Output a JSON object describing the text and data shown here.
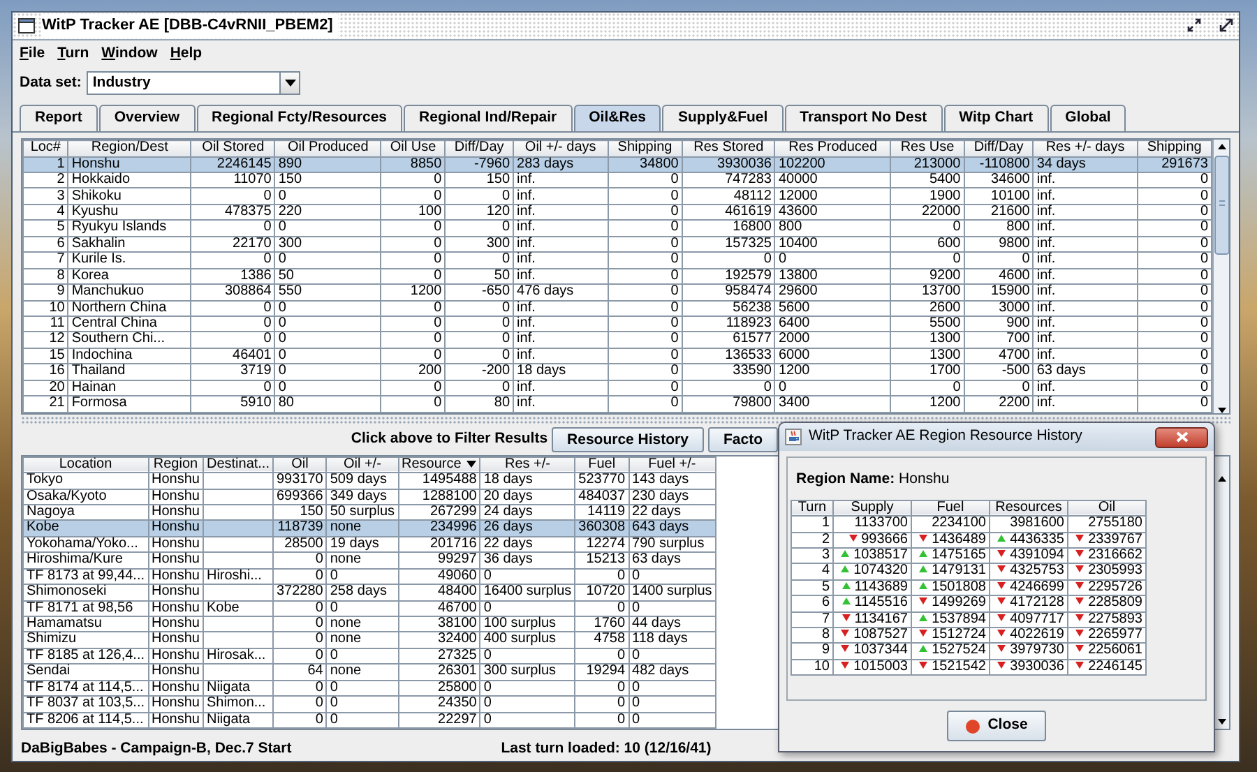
{
  "window": {
    "title": "WitP Tracker AE [DBB-C4vRNII_PBEM2]"
  },
  "menu": [
    "File",
    "Turn",
    "Window",
    "Help"
  ],
  "data_set": {
    "label": "Data set:",
    "value": "Industry"
  },
  "tabs": [
    {
      "label": "Report",
      "selected": false
    },
    {
      "label": "Overview",
      "selected": false
    },
    {
      "label": "Regional Fcty/Resources",
      "selected": false
    },
    {
      "label": "Regional Ind/Repair",
      "selected": false
    },
    {
      "label": "Oil&Res",
      "selected": true
    },
    {
      "label": "Supply&Fuel",
      "selected": false
    },
    {
      "label": "Transport No Dest",
      "selected": false
    },
    {
      "label": "Witp Chart",
      "selected": false
    },
    {
      "label": "Global",
      "selected": false
    }
  ],
  "top_table": {
    "columns": [
      "Loc#",
      "Region/Dest",
      "Oil Stored",
      "Oil Produced",
      "Oil Use",
      "Diff/Day",
      "Oil +/- days",
      "Shipping",
      "Res Stored",
      "Res Produced",
      "Res Use",
      "Diff/Day",
      "Res +/- days",
      "Shipping"
    ],
    "rows": [
      {
        "selected": true,
        "cells": [
          "1",
          "Honshu",
          "2246145",
          "890",
          "8850",
          "-7960",
          "283 days",
          "34800",
          "3930036",
          "102200",
          "213000",
          "-110800",
          "34 days",
          "291673"
        ]
      },
      {
        "selected": false,
        "cells": [
          "2",
          "Hokkaido",
          "11070",
          "150",
          "0",
          "150",
          "inf.",
          "0",
          "747283",
          "40000",
          "5400",
          "34600",
          "inf.",
          "0"
        ]
      },
      {
        "selected": false,
        "cells": [
          "3",
          "Shikoku",
          "0",
          "0",
          "0",
          "0",
          "inf.",
          "0",
          "48112",
          "12000",
          "1900",
          "10100",
          "inf.",
          "0"
        ]
      },
      {
        "selected": false,
        "cells": [
          "4",
          "Kyushu",
          "478375",
          "220",
          "100",
          "120",
          "inf.",
          "0",
          "461619",
          "43600",
          "22000",
          "21600",
          "inf.",
          "0"
        ]
      },
      {
        "selected": false,
        "cells": [
          "5",
          "Ryukyu Islands",
          "0",
          "0",
          "0",
          "0",
          "inf.",
          "0",
          "16800",
          "800",
          "0",
          "800",
          "inf.",
          "0"
        ]
      },
      {
        "selected": false,
        "cells": [
          "6",
          "Sakhalin",
          "22170",
          "300",
          "0",
          "300",
          "inf.",
          "0",
          "157325",
          "10400",
          "600",
          "9800",
          "inf.",
          "0"
        ]
      },
      {
        "selected": false,
        "cells": [
          "7",
          "Kurile Is.",
          "0",
          "0",
          "0",
          "0",
          "inf.",
          "0",
          "0",
          "0",
          "0",
          "0",
          "inf.",
          "0"
        ]
      },
      {
        "selected": false,
        "cells": [
          "8",
          "Korea",
          "1386",
          "50",
          "0",
          "50",
          "inf.",
          "0",
          "192579",
          "13800",
          "9200",
          "4600",
          "inf.",
          "0"
        ]
      },
      {
        "selected": false,
        "cells": [
          "9",
          "Manchukuo",
          "308864",
          "550",
          "1200",
          "-650",
          "476 days",
          "0",
          "958474",
          "29600",
          "13700",
          "15900",
          "inf.",
          "0"
        ]
      },
      {
        "selected": false,
        "cells": [
          "10",
          "Northern China",
          "0",
          "0",
          "0",
          "0",
          "inf.",
          "0",
          "56238",
          "5600",
          "2600",
          "3000",
          "inf.",
          "0"
        ]
      },
      {
        "selected": false,
        "cells": [
          "11",
          "Central China",
          "0",
          "0",
          "0",
          "0",
          "inf.",
          "0",
          "118923",
          "6400",
          "5500",
          "900",
          "inf.",
          "0"
        ]
      },
      {
        "selected": false,
        "cells": [
          "12",
          "Southern Chi...",
          "0",
          "0",
          "0",
          "0",
          "inf.",
          "0",
          "61577",
          "2000",
          "1300",
          "700",
          "inf.",
          "0"
        ]
      },
      {
        "selected": false,
        "cells": [
          "15",
          "Indochina",
          "46401",
          "0",
          "0",
          "0",
          "inf.",
          "0",
          "136533",
          "6000",
          "1300",
          "4700",
          "inf.",
          "0"
        ]
      },
      {
        "selected": false,
        "cells": [
          "16",
          "Thailand",
          "3719",
          "0",
          "200",
          "-200",
          "18 days",
          "0",
          "33590",
          "1200",
          "1700",
          "-500",
          "63 days",
          "0"
        ]
      },
      {
        "selected": false,
        "cells": [
          "20",
          "Hainan",
          "0",
          "0",
          "0",
          "0",
          "inf.",
          "0",
          "0",
          "0",
          "0",
          "0",
          "inf.",
          "0"
        ]
      },
      {
        "selected": false,
        "cells": [
          "21",
          "Formosa",
          "5910",
          "80",
          "0",
          "80",
          "inf.",
          "0",
          "79800",
          "3400",
          "1200",
          "2200",
          "inf.",
          "0"
        ]
      }
    ]
  },
  "filter_bar": {
    "hint": "Click above to Filter Results",
    "buttons": [
      "Resource History",
      "Facto"
    ]
  },
  "bottom_table": {
    "columns": [
      {
        "label": "Location",
        "sorted": false
      },
      {
        "label": "Region",
        "sorted": false
      },
      {
        "label": "Destinat...",
        "sorted": false
      },
      {
        "label": "Oil",
        "sorted": false
      },
      {
        "label": "Oil +/-",
        "sorted": false
      },
      {
        "label": "Resource",
        "sorted": true
      },
      {
        "label": "Res +/-",
        "sorted": false
      },
      {
        "label": "Fuel",
        "sorted": false
      },
      {
        "label": "Fuel +/-",
        "sorted": false
      }
    ],
    "rows": [
      {
        "selected": false,
        "location": "Tokyo",
        "region": "Honshu",
        "oil": "993170",
        "oil_change": "509 days",
        "resource": "1495488",
        "res_change": "18 days",
        "fuel": "523770",
        "fuel_change": "143 days"
      },
      {
        "selected": false,
        "location": "Osaka/Kyoto",
        "region": "Honshu",
        "oil": "699366",
        "oil_change": "349 days",
        "resource": "1288100",
        "res_change": "20 days",
        "fuel": "484037",
        "fuel_change": "230 days"
      },
      {
        "selected": false,
        "location": "Nagoya",
        "region": "Honshu",
        "oil": "150",
        "oil_change": "50 surplus",
        "resource": "267299",
        "res_change": "24 days",
        "fuel": "14119",
        "fuel_change": "22 days"
      },
      {
        "selected": true,
        "location": "Kobe",
        "region": "Honshu",
        "oil": "118739",
        "oil_change": "none",
        "resource": "234996",
        "res_change": "26 days",
        "fuel": "360308",
        "fuel_change": "643 days"
      },
      {
        "selected": false,
        "location": "Yokohama/Yoko...",
        "region": "Honshu",
        "oil": "28500",
        "oil_change": "19 days",
        "resource": "201716",
        "res_change": "22 days",
        "fuel": "12274",
        "fuel_change": "790 surplus"
      },
      {
        "selected": false,
        "location": "Hiroshima/Kure",
        "region": "Honshu",
        "oil": "0",
        "oil_change": "none",
        "resource": "99297",
        "res_change": "36 days",
        "fuel": "15213",
        "fuel_change": "63 days"
      },
      {
        "selected": false,
        "location": "TF 8173 at 99,44...",
        "region": "Honshu",
        "destination": "Hiroshi...",
        "oil": "0",
        "oil_change": "0",
        "resource": "49060",
        "res_change": "0",
        "fuel": "0",
        "fuel_change": "0"
      },
      {
        "selected": false,
        "location": "Shimonoseki",
        "region": "Honshu",
        "oil": "372280",
        "oil_change": "258 days",
        "resource": "48400",
        "res_change": "16400 surplus",
        "fuel": "10720",
        "fuel_change": "1400 surplus"
      },
      {
        "selected": false,
        "location": "TF 8171 at 98,56",
        "region": "Honshu",
        "destination": "Kobe",
        "oil": "0",
        "oil_change": "0",
        "resource": "46700",
        "res_change": "0",
        "fuel": "0",
        "fuel_change": "0"
      },
      {
        "selected": false,
        "location": "Hamamatsu",
        "region": "Honshu",
        "oil": "0",
        "oil_change": "none",
        "resource": "38100",
        "res_change": "100 surplus",
        "fuel": "1760",
        "fuel_change": "44 days"
      },
      {
        "selected": false,
        "location": "Shimizu",
        "region": "Honshu",
        "oil": "0",
        "oil_change": "none",
        "resource": "32400",
        "res_change": "400 surplus",
        "fuel": "4758",
        "fuel_change": "118 days"
      },
      {
        "selected": false,
        "location": "TF 8185 at 126,4...",
        "region": "Honshu",
        "destination": "Hirosak...",
        "oil": "0",
        "oil_change": "0",
        "resource": "27325",
        "res_change": "0",
        "fuel": "0",
        "fuel_change": "0"
      },
      {
        "selected": false,
        "location": "Sendai",
        "region": "Honshu",
        "oil": "64",
        "oil_change": "none",
        "resource": "26301",
        "res_change": "300 surplus",
        "fuel": "19294",
        "fuel_change": "482 days"
      },
      {
        "selected": false,
        "location": "TF 8174 at 114,5...",
        "region": "Honshu",
        "destination": "Niigata",
        "oil": "0",
        "oil_change": "0",
        "resource": "25800",
        "res_change": "0",
        "fuel": "0",
        "fuel_change": "0"
      },
      {
        "selected": false,
        "location": "TF 8037 at 103,5...",
        "region": "Honshu",
        "destination": "Shimon...",
        "oil": "0",
        "oil_change": "0",
        "resource": "24350",
        "res_change": "0",
        "fuel": "0",
        "fuel_change": "0"
      },
      {
        "selected": false,
        "location": "TF 8206 at 114,5...",
        "region": "Honshu",
        "destination": "Niigata",
        "oil": "0",
        "oil_change": "0",
        "resource": "22297",
        "res_change": "0",
        "fuel": "0",
        "fuel_change": "0"
      }
    ]
  },
  "status_bar": {
    "left": "DaBigBabes - Campaign-B, Dec.7 Start",
    "right": "Last turn loaded: 10 (12/16/41)"
  },
  "dialog": {
    "title": "WitP Tracker AE Region Resource History",
    "region_label": "Region Name:",
    "region_value": "Honshu",
    "columns": [
      "Turn",
      "Supply",
      "Fuel",
      "Resources",
      "Oil"
    ],
    "rows": [
      [
        {
          "v": "1",
          "kind": "plain"
        },
        {
          "v": "1133700",
          "kind": "plain"
        },
        {
          "v": "2234100",
          "kind": "plain"
        },
        {
          "v": "3981600",
          "kind": "plain"
        },
        {
          "v": "2755180",
          "kind": "plain"
        }
      ],
      [
        {
          "v": "2",
          "kind": "plain"
        },
        {
          "v": "993666",
          "kind": "fall"
        },
        {
          "v": "1436489",
          "kind": "fall"
        },
        {
          "v": "4436335",
          "kind": "rise"
        },
        {
          "v": "2339767",
          "kind": "fall"
        }
      ],
      [
        {
          "v": "3",
          "kind": "plain"
        },
        {
          "v": "1038517",
          "kind": "rise"
        },
        {
          "v": "1475165",
          "kind": "rise"
        },
        {
          "v": "4391094",
          "kind": "fall"
        },
        {
          "v": "2316662",
          "kind": "fall"
        }
      ],
      [
        {
          "v": "4",
          "kind": "plain"
        },
        {
          "v": "1074320",
          "kind": "rise"
        },
        {
          "v": "1479131",
          "kind": "rise"
        },
        {
          "v": "4325753",
          "kind": "fall"
        },
        {
          "v": "2305993",
          "kind": "fall"
        }
      ],
      [
        {
          "v": "5",
          "kind": "plain"
        },
        {
          "v": "1143689",
          "kind": "rise"
        },
        {
          "v": "1501808",
          "kind": "rise"
        },
        {
          "v": "4246699",
          "kind": "fall"
        },
        {
          "v": "2295726",
          "kind": "fall"
        }
      ],
      [
        {
          "v": "6",
          "kind": "plain"
        },
        {
          "v": "1145516",
          "kind": "rise"
        },
        {
          "v": "1499269",
          "kind": "fall"
        },
        {
          "v": "4172128",
          "kind": "fall"
        },
        {
          "v": "2285809",
          "kind": "fall"
        }
      ],
      [
        {
          "v": "7",
          "kind": "plain"
        },
        {
          "v": "1134167",
          "kind": "fall"
        },
        {
          "v": "1537894",
          "kind": "rise"
        },
        {
          "v": "4097717",
          "kind": "fall"
        },
        {
          "v": "2275893",
          "kind": "fall"
        }
      ],
      [
        {
          "v": "8",
          "kind": "plain"
        },
        {
          "v": "1087527",
          "kind": "fall"
        },
        {
          "v": "1512724",
          "kind": "fall"
        },
        {
          "v": "4022619",
          "kind": "fall"
        },
        {
          "v": "2265977",
          "kind": "fall"
        }
      ],
      [
        {
          "v": "9",
          "kind": "plain"
        },
        {
          "v": "1037344",
          "kind": "fall"
        },
        {
          "v": "1527524",
          "kind": "rise"
        },
        {
          "v": "3979730",
          "kind": "fall"
        },
        {
          "v": "2256061",
          "kind": "fall"
        }
      ],
      [
        {
          "v": "10",
          "kind": "plain"
        },
        {
          "v": "1015003",
          "kind": "fall"
        },
        {
          "v": "1521542",
          "kind": "fall"
        },
        {
          "v": "3930036",
          "kind": "fall"
        },
        {
          "v": "2246145",
          "kind": "fall"
        }
      ]
    ],
    "button": "Close"
  }
}
